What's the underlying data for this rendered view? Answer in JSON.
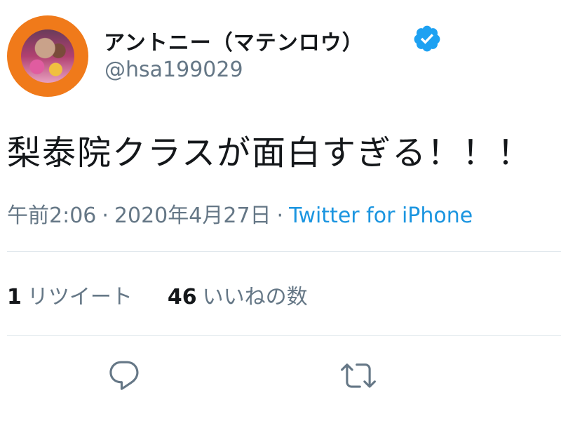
{
  "user": {
    "display_name": "アントニー（マテンロウ）",
    "handle": "@hsa199029",
    "verified": true,
    "avatar_icon": "profile-avatar"
  },
  "tweet": {
    "text": "梨泰院クラスが面白すぎる！！！"
  },
  "meta": {
    "time": "午前2:06",
    "separator": "·",
    "date": "2020年4月27日",
    "source": "Twitter for iPhone"
  },
  "stats": {
    "retweets_count": "1",
    "retweets_label": "リツイート",
    "likes_count": "46",
    "likes_label": "いいねの数"
  },
  "actions": {
    "reply_icon": "reply-icon",
    "retweet_icon": "retweet-icon"
  },
  "colors": {
    "text": "#14171a",
    "muted": "#657786",
    "link": "#1b95e0",
    "verified": "#1da1f2",
    "divider": "#e1e8ed",
    "avatar_ring": "#f07a1a"
  }
}
